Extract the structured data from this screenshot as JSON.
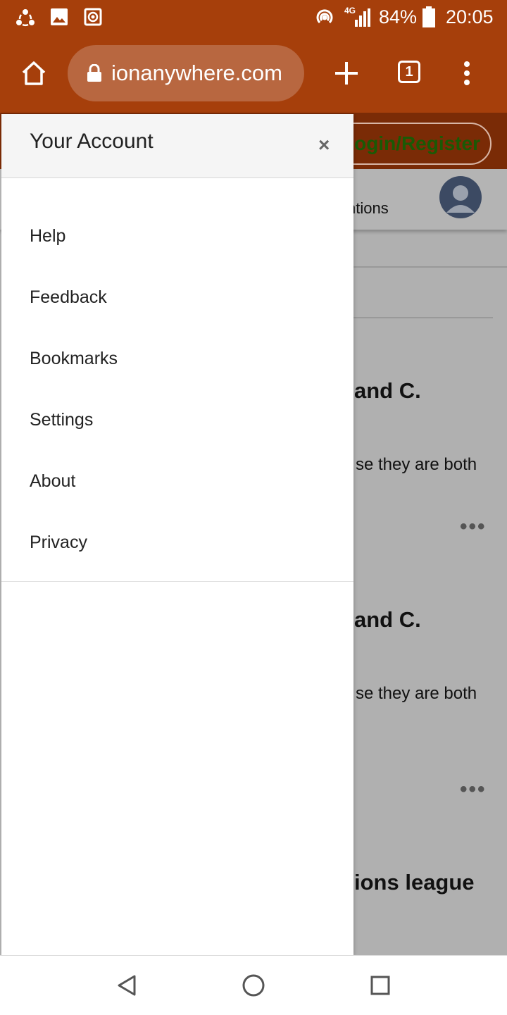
{
  "status_bar": {
    "battery": "84%",
    "time": "20:05",
    "network": "4G"
  },
  "browser": {
    "url": "ionanywhere.com",
    "tab_count": "1"
  },
  "background_page": {
    "login_label": "Login/Register",
    "tab_fragment": "ntions",
    "card_1_title": "and C.",
    "card_1_snippet": "se they are both",
    "card_2_title": "and C.",
    "card_2_snippet": "se they are both",
    "card_3_title": "ions league",
    "more": "•••"
  },
  "drawer": {
    "title": "Your Account",
    "close": "×",
    "items": [
      {
        "label": "Help"
      },
      {
        "label": "Feedback"
      },
      {
        "label": "Bookmarks"
      },
      {
        "label": "Settings"
      },
      {
        "label": "About"
      },
      {
        "label": "Privacy"
      }
    ]
  },
  "colors": {
    "toolbar": "#a63f0b",
    "login_text": "#1a5a05"
  }
}
